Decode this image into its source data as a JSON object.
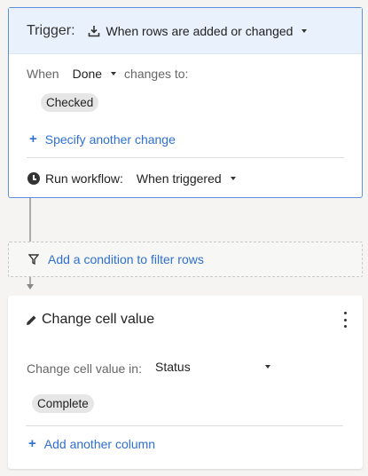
{
  "trigger": {
    "label": "Trigger:",
    "event_select": "When rows are added or changed",
    "when_label": "When",
    "column_select": "Done",
    "changes_to_label": "changes to:",
    "value_chip": "Checked",
    "add_change_link": "Specify another change",
    "run_label": "Run workflow:",
    "run_select": "When triggered"
  },
  "condition": {
    "link": "Add a condition to filter rows"
  },
  "action": {
    "title": "Change cell value",
    "change_in_label": "Change cell value in:",
    "column_select": "Status",
    "value_chip": "Complete",
    "add_column_link": "Add another column"
  },
  "colors": {
    "accent": "#2f6fd1",
    "trigger_border": "#5b8fd9",
    "trigger_header_bg": "#e9f1fd"
  },
  "icons": {
    "trigger": "cloud-download-icon",
    "run": "clock-icon",
    "condition": "filter-icon",
    "action": "pencil-icon",
    "menu": "kebab-menu-icon"
  }
}
